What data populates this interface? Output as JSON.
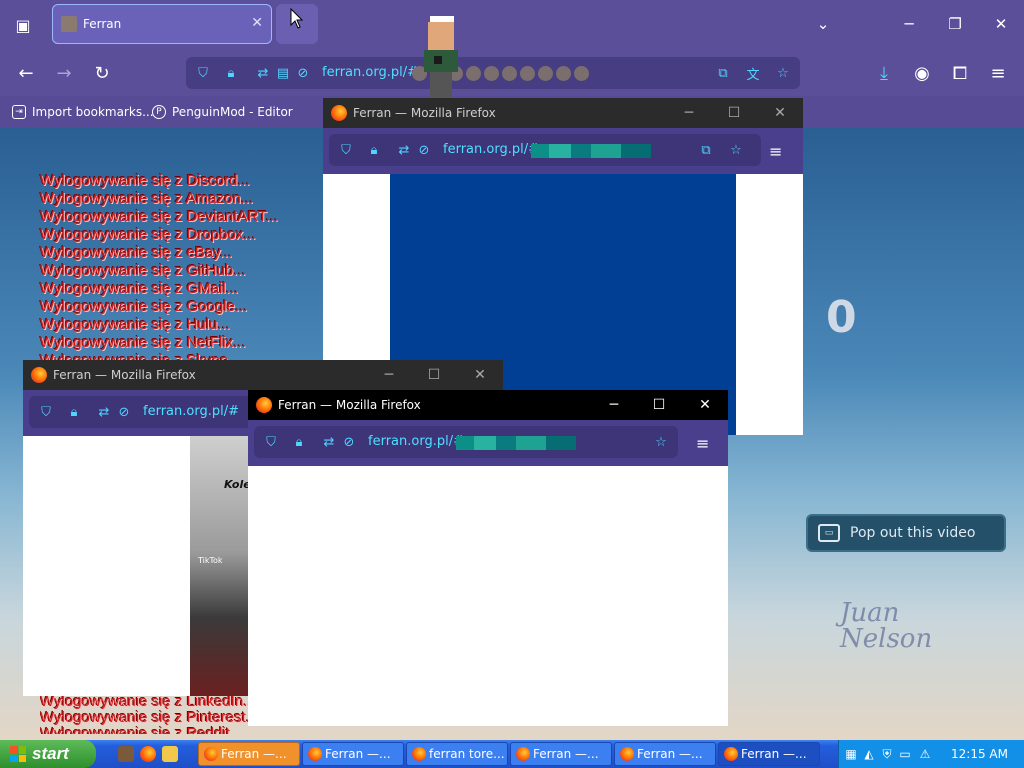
{
  "main_window": {
    "tab_title": "Ferran",
    "url": "ferran.org.pl/#",
    "bookmarks": [
      {
        "label": "Import bookmarks..."
      },
      {
        "label": "PenguinMod - Editor"
      }
    ]
  },
  "page": {
    "logout_messages": [
      "Wylogowywanie się z Discord...",
      "Wylogowywanie się z Amazon...",
      "Wylogowywanie się z DeviantART...",
      "Wylogowywanie się z Dropbox...",
      "Wylogowywanie się z eBay...",
      "Wylogowywanie się z GitHub...",
      "Wylogowywanie się z GMail...",
      "Wylogowywanie się z Google...",
      "Wylogowywanie się z Hulu...",
      "Wylogowywanie się z NetFlix...",
      "Wylogowywanie się z Skype..."
    ],
    "logout_messages_bottom": [
      "Wylogowywanie się z LinkedIn...",
      "Wylogowywanie się z Pinterest...",
      "Wylogowywanie się z Reddit..."
    ],
    "counter": "0",
    "popout_label": "Pop out this video",
    "signature_line1": "Juan",
    "signature_line2": "Nelson"
  },
  "popups": {
    "window_title": "Ferran — Mozilla Firefox",
    "url": "ferran.org.pl/#",
    "overlay_text": "Kole",
    "tiktok_label": "TikTok"
  },
  "taskbar": {
    "start_label": "start",
    "buttons": [
      {
        "label": "Ferran —..."
      },
      {
        "label": "Ferran —..."
      },
      {
        "label": "ferran tore..."
      },
      {
        "label": "Ferran —..."
      },
      {
        "label": "Ferran —..."
      },
      {
        "label": "Ferran —..."
      }
    ],
    "clock": "12:15 AM"
  },
  "colors": {
    "chrome": "#5b4f9a",
    "url_text": "#4fe0ff",
    "logout_text": "#d11d1d",
    "popup_blue": "#003f93",
    "taskbar": "#245edb",
    "start_green": "#3c9c38"
  }
}
